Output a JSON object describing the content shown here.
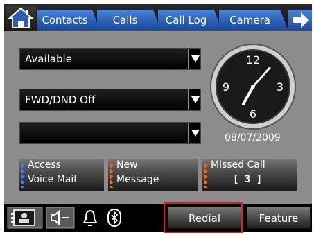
{
  "tabs": [
    {
      "label": "Contacts"
    },
    {
      "label": "Calls"
    },
    {
      "label": "Call Log"
    },
    {
      "label": "Camera"
    }
  ],
  "dropdowns": {
    "presence": "Available",
    "forwarding": "FWD/DND Off",
    "third": ""
  },
  "clock": {
    "numerals": [
      "12",
      "3",
      "6",
      "9"
    ],
    "date": "08/07/2009"
  },
  "status": {
    "voicemail_line1": "Access",
    "voicemail_line2": "Voice Mail",
    "message_line1": "New",
    "message_line2": "Message",
    "missed_line1": "Missed Call",
    "missed_count": "[ 3 ]"
  },
  "softkeys": {
    "redial": "Redial",
    "feature": "Feature"
  },
  "colors": {
    "tab_blue": "#2a5fb5",
    "panel_gray": "#8c8c8c",
    "highlight_red": "#e02020",
    "stripe_blue": "#3b82f6",
    "stripe_orange": "#f26b1d"
  },
  "icons": {
    "home": "home-icon",
    "next": "arrow-right-icon",
    "phonebook": "phonebook-icon",
    "speaker": "speaker-volume-icon",
    "bell": "bell-icon",
    "bluetooth": "bluetooth-icon"
  }
}
